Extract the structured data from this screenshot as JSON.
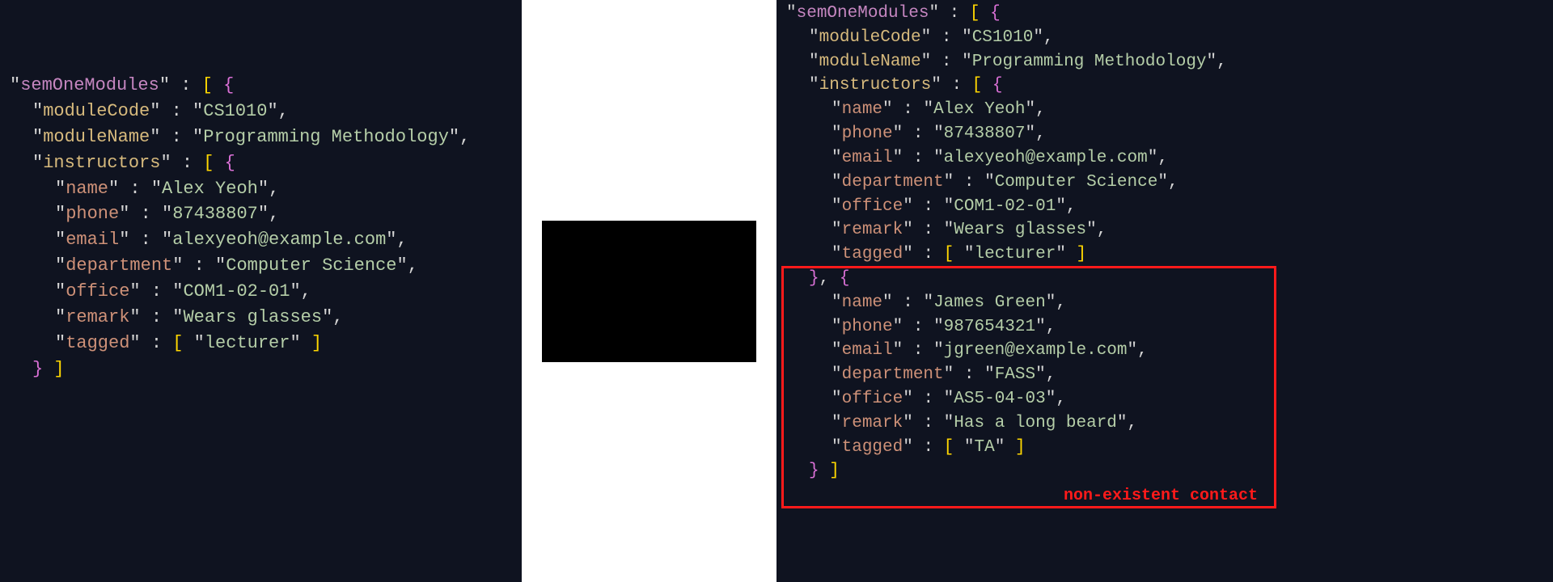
{
  "topKey": "semOneModules",
  "module": {
    "codeKey": "moduleCode",
    "codeVal": "CS1010",
    "nameKey": "moduleName",
    "nameVal": "Programming Methodology",
    "instructorsKey": "instructors"
  },
  "inst1": {
    "nameKey": "name",
    "nameVal": "Alex Yeoh",
    "phoneKey": "phone",
    "phoneVal": "87438807",
    "emailKey": "email",
    "emailVal": "alexyeoh@example.com",
    "deptKey": "department",
    "deptVal": "Computer Science",
    "officeKey": "office",
    "officeVal": "COM1-02-01",
    "remarkKey": "remark",
    "remarkVal": "Wears glasses",
    "taggedKey": "tagged",
    "taggedVal": "lecturer"
  },
  "inst2": {
    "nameKey": "name",
    "nameVal": "James Green",
    "phoneKey": "phone",
    "phoneVal": "987654321",
    "emailKey": "email",
    "emailVal": "jgreen@example.com",
    "deptKey": "department",
    "deptVal": "FASS",
    "officeKey": "office",
    "officeVal": "AS5-04-03",
    "remarkKey": "remark",
    "remarkVal": "Has a long beard",
    "taggedKey": "tagged",
    "taggedVal": "TA"
  },
  "annotation": "non-existent contact"
}
